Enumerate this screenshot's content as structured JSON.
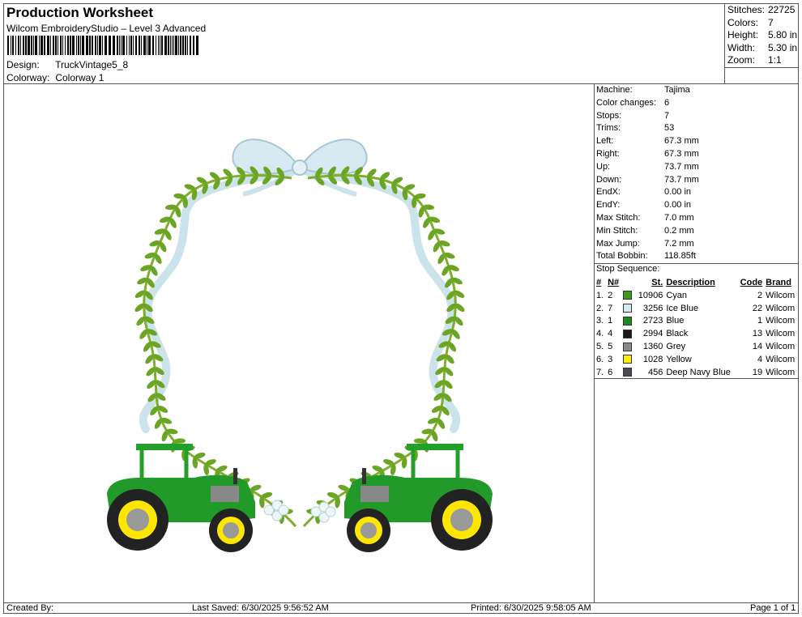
{
  "header": {
    "title": "Production Worksheet",
    "subtitle": "Wilcom EmbroideryStudio – Level 3 Advanced",
    "design_label": "Design:",
    "design_value": "TruckVintage5_8",
    "colorway_label": "Colorway:",
    "colorway_value": "Colorway 1"
  },
  "stats": [
    {
      "label": "Stitches:",
      "value": "22725"
    },
    {
      "label": "Colors:",
      "value": "7"
    },
    {
      "label": "Height:",
      "value": "5.80 in"
    },
    {
      "label": "Width:",
      "value": "5.30 in"
    },
    {
      "label": "Zoom:",
      "value": "1:1"
    }
  ],
  "properties": [
    {
      "label": "Machine:",
      "value": "Tajima"
    },
    {
      "label": "Color changes:",
      "value": "6"
    },
    {
      "label": "Stops:",
      "value": "7"
    },
    {
      "label": "Trims:",
      "value": "53"
    },
    {
      "label": "Left:",
      "value": "67.3 mm"
    },
    {
      "label": "Right:",
      "value": "67.3 mm"
    },
    {
      "label": "Up:",
      "value": "73.7 mm"
    },
    {
      "label": "Down:",
      "value": "73.7 mm"
    },
    {
      "label": "EndX:",
      "value": "0.00 in"
    },
    {
      "label": "EndY:",
      "value": "0.00 in"
    },
    {
      "label": "Max Stitch:",
      "value": "7.0 mm"
    },
    {
      "label": "Min Stitch:",
      "value": "0.2 mm"
    },
    {
      "label": "Max Jump:",
      "value": "7.2 mm"
    },
    {
      "label": "Total Bobbin:",
      "value": "118.85ft"
    }
  ],
  "stop_sequence": {
    "title": "Stop Sequence:",
    "headers": {
      "idx": "#",
      "n": "N#",
      "st": "St.",
      "desc": "Description",
      "code": "Code",
      "brand": "Brand"
    },
    "rows": [
      {
        "idx": "1.",
        "n": "2",
        "color": "#3f9a1a",
        "st": "10906",
        "desc": "Cyan",
        "code": "2",
        "brand": "Wilcom"
      },
      {
        "idx": "2.",
        "n": "7",
        "color": "#d6eaf2",
        "st": "3256",
        "desc": "Ice Blue",
        "code": "22",
        "brand": "Wilcom"
      },
      {
        "idx": "3.",
        "n": "1",
        "color": "#1f8a1f",
        "st": "2723",
        "desc": "Blue",
        "code": "1",
        "brand": "Wilcom"
      },
      {
        "idx": "4.",
        "n": "4",
        "color": "#1a1a1a",
        "st": "2994",
        "desc": "Black",
        "code": "13",
        "brand": "Wilcom"
      },
      {
        "idx": "5.",
        "n": "5",
        "color": "#8a8a8a",
        "st": "1360",
        "desc": "Grey",
        "code": "14",
        "brand": "Wilcom"
      },
      {
        "idx": "6.",
        "n": "3",
        "color": "#ffee00",
        "st": "1028",
        "desc": "Yellow",
        "code": "4",
        "brand": "Wilcom"
      },
      {
        "idx": "7.",
        "n": "6",
        "color": "#4a4a52",
        "st": "456",
        "desc": "Deep Navy Blue",
        "code": "19",
        "brand": "Wilcom"
      }
    ]
  },
  "footer": {
    "created": "Created By:",
    "saved": "Last Saved: 6/30/2025 9:56:52 AM",
    "printed": "Printed: 6/30/2025 9:58:05 AM",
    "page": "Page 1 of 1"
  }
}
